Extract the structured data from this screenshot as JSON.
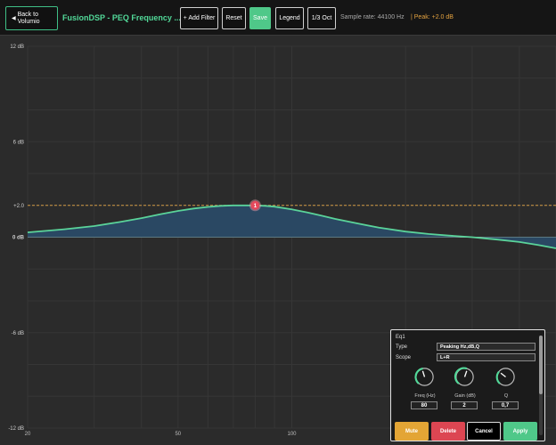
{
  "toolbar": {
    "back_label": "Back to Volumio",
    "back_icon": "triangle-left-icon",
    "title": "FusionDSP - PEQ Frequency ...",
    "add_filter_label": "+ Add Filter",
    "reset_label": "Reset",
    "save_label": "Save",
    "legend_label": "Legend",
    "octave_label": "1/3 Oct",
    "sample_rate": "Sample rate: 44100 Hz",
    "peak": "| Peak: +2.0 dB"
  },
  "colors": {
    "accent": "#52d999",
    "curve": "#5ad39a",
    "fill": "#2a4a66",
    "peak_line": "#d39a45",
    "marker": "#e5495c",
    "save": "#4fc889",
    "mute": "#e3a535",
    "delete": "#dc4652"
  },
  "chart_data": {
    "type": "area",
    "x_scale": "log",
    "xlim": [
      20,
      500
    ],
    "ylim": [
      -12,
      12
    ],
    "x_ticks": [
      {
        "value": 20,
        "label": "20"
      },
      {
        "value": 50,
        "label": "50"
      },
      {
        "value": 100,
        "label": "100"
      },
      {
        "value": 200,
        "label": "200"
      }
    ],
    "y_ticks": [
      {
        "value": 12,
        "label": "12 dB"
      },
      {
        "value": 6,
        "label": "6 dB"
      },
      {
        "value": 0,
        "label": "0 dB"
      },
      {
        "value": -6,
        "label": "-6 dB"
      },
      {
        "value": -12,
        "label": "-12 dB"
      }
    ],
    "peak_line": {
      "value": 2.0,
      "label": "+2.0"
    },
    "filters": [
      {
        "id": "1",
        "type": "Peaking",
        "freq": 80,
        "gain": 2,
        "q": 0.7
      }
    ],
    "series": [
      {
        "x": [
          20,
          25,
          30,
          35,
          40,
          45,
          50,
          55,
          60,
          65,
          70,
          75,
          80,
          85,
          90,
          100,
          110,
          120,
          130,
          150,
          170,
          200,
          230,
          260,
          300,
          350,
          400,
          450,
          500
        ],
        "values": [
          0.3,
          0.5,
          0.7,
          0.95,
          1.2,
          1.45,
          1.65,
          1.8,
          1.9,
          1.97,
          2.0,
          2.0,
          2.0,
          1.97,
          1.92,
          1.75,
          1.55,
          1.35,
          1.15,
          0.85,
          0.6,
          0.35,
          0.2,
          0.1,
          0.0,
          -0.15,
          -0.3,
          -0.5,
          -0.7
        ]
      }
    ],
    "grid": true
  },
  "panel": {
    "title": "Eq1",
    "type_label": "Type",
    "type_value": "Peaking Hz,dB,Q",
    "scope_label": "Scope",
    "scope_value": "L+R",
    "knobs": [
      {
        "label": "Freq (Hz)",
        "value": "80"
      },
      {
        "label": "Gain (dB)",
        "value": "2"
      },
      {
        "label": "Q",
        "value": "0,7"
      }
    ],
    "mute_label": "Mute",
    "delete_label": "Delete",
    "cancel_label": "Cancel",
    "apply_label": "Apply"
  }
}
